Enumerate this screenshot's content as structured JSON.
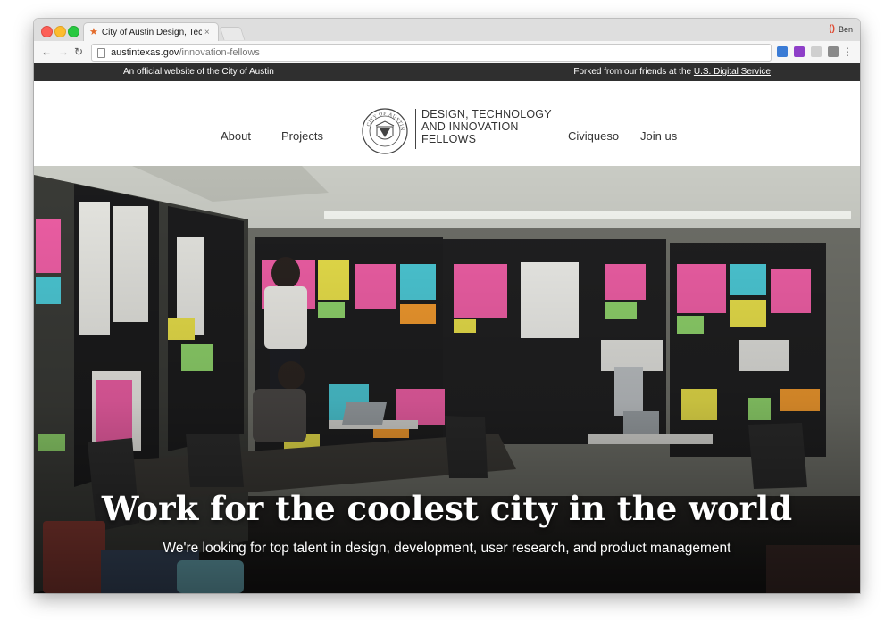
{
  "browser": {
    "tab_title": "City of Austin Design, Technol",
    "tab_close": "×",
    "profile_name": "Ben",
    "url_host": "austintexas.gov",
    "url_path": "/innovation-fellows",
    "back_icon": "←",
    "forward_icon": "→",
    "reload_icon": "↻",
    "menu_icon": "⋮"
  },
  "banner": {
    "official_text": "An official website of the City of Austin",
    "forked_text": "Forked from our friends at the ",
    "forked_link": "U.S. Digital Service"
  },
  "nav": {
    "about": "About",
    "projects": "Projects",
    "civiqueso": "Civiqueso",
    "join_us": "Join us"
  },
  "logo": {
    "line1": "DESIGN, TECHNOLOGY",
    "line2": "AND INNOVATION",
    "line3": "FELLOWS",
    "seal_text": "CITY OF AUSTIN"
  },
  "hero": {
    "title": "Work for the coolest city in the world",
    "subtitle": "We're looking for top talent in design, development, user research, and product management"
  },
  "colors": {
    "banner_bg": "#2f2f2f",
    "sticky_pink": "#f05fa6",
    "sticky_cyan": "#4cc9d6",
    "sticky_yellow": "#e9e04a",
    "sticky_green": "#8fd36b",
    "sticky_orange": "#f29a2e"
  }
}
